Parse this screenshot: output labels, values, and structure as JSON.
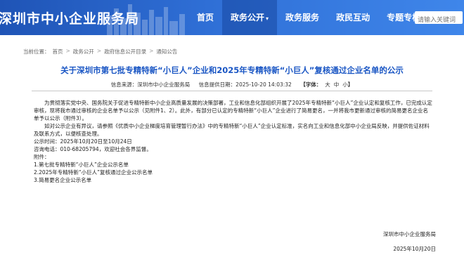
{
  "header": {
    "site_title": "深圳市中小企业服务局",
    "nav": [
      {
        "label": "首页"
      },
      {
        "label": "政务公开",
        "arrow": "▾"
      },
      {
        "label": "政务服务"
      },
      {
        "label": "政民互动"
      },
      {
        "label": "专题专栏"
      }
    ],
    "search_placeholder": "请输入关键词"
  },
  "breadcrumb": {
    "prefix": "当前位置：",
    "items": [
      "首页",
      "政务公开",
      "政府信息公开目录",
      "通知公告"
    ],
    "separator": ">"
  },
  "article": {
    "title": "关于深圳市第七批专精特新“小巨人”企业和2025年专精特新“小巨人”复核通过企业名单的公示",
    "meta": {
      "source": "信息来源：深圳市中小企业服务局",
      "date": "信息提供日期：2025-10-20 14:03:32",
      "font_label": "【字体：",
      "font_large": "大",
      "font_medium": "中",
      "font_small": "小",
      "font_end": "】"
    },
    "intro": "为贯彻落实党中央、国务院关于促进专精特新中小企业高质量发展的决策部署，工业和信息化部组织开展了2025年专精特新“小巨人”企业认定和复核工作，已完成认定审核，现将我市通过审核的企业名单予以公示（见附件1、2）。此外，有部分已认定的专精特新“小巨人”企业进行了简易更名，一并将我市更新通过审核的简易更名企业名单予以公示（附件3）。",
    "objection": "如对公示企业有异议，请参照《优质中小企业梯度培育管理暂行办法》中的专精特新“小巨人”企业认定标准，实名向工业和信息化部中小企业局反映，并提供佐证材料及联系方式，以便核查处理。",
    "period": "公示时间：2025年10月20日至10月24日",
    "contact": "咨询电话：010-68205794，欢迎社会各界监督。",
    "attachments_label": "附件：",
    "attachments": [
      "1.第七批专精特新“小巨人”企业公示名单",
      "2.2025年专精特新“小巨人”复核通过企业公示名单",
      "3.简易更名企业公示名单"
    ],
    "signature": "深圳市中小企业服务局",
    "sign_date": "2025年10月20日"
  }
}
